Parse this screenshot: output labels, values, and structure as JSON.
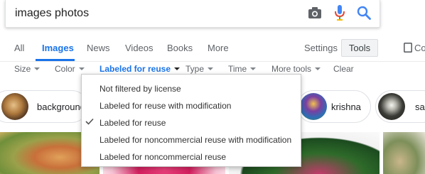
{
  "search": {
    "query": "images photos"
  },
  "tabs": [
    {
      "label": "All"
    },
    {
      "label": "Images"
    },
    {
      "label": "News"
    },
    {
      "label": "Videos"
    },
    {
      "label": "Books"
    },
    {
      "label": "More"
    }
  ],
  "header_right": {
    "settings": "Settings",
    "tools": "Tools",
    "collections": "Col"
  },
  "filters": [
    {
      "label": "Size"
    },
    {
      "label": "Color"
    },
    {
      "label": "Labeled for reuse"
    },
    {
      "label": "Type"
    },
    {
      "label": "Time"
    },
    {
      "label": "More tools"
    },
    {
      "label": "Clear"
    }
  ],
  "chips": [
    {
      "label": "background"
    },
    {
      "label": "krishna"
    },
    {
      "label": "sa"
    }
  ],
  "usage_menu": {
    "items": [
      {
        "label": "Not filtered by license",
        "selected": false
      },
      {
        "label": "Labeled for reuse with modification",
        "selected": false
      },
      {
        "label": "Labeled for reuse",
        "selected": true
      },
      {
        "label": "Labeled for noncommercial reuse with modification",
        "selected": false
      },
      {
        "label": "Labeled for noncommercial reuse",
        "selected": false
      }
    ]
  },
  "colors": {
    "accent": "#1a73e8",
    "tab_inactive": "#5f6368",
    "mic_blue": "#4285f4",
    "mic_red": "#ea4335"
  }
}
